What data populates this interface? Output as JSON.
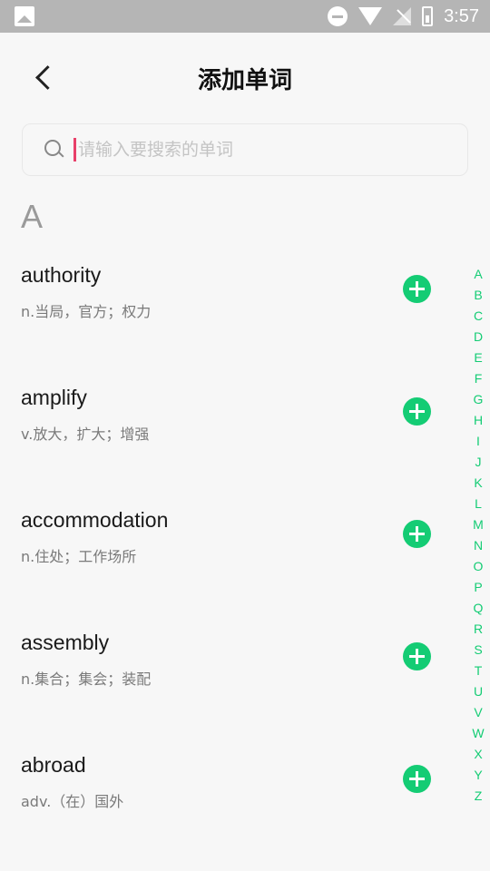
{
  "status_bar": {
    "time": "3:57",
    "icons": [
      "gallery-icon",
      "do-not-disturb-icon",
      "wifi-icon",
      "signal-off-icon",
      "battery-icon"
    ]
  },
  "header": {
    "title": "添加单词",
    "back_icon": "chevron-left-icon"
  },
  "search": {
    "placeholder": "请输入要搜索的单词",
    "value": ""
  },
  "section": {
    "letter": "A"
  },
  "words": [
    {
      "word": "authority",
      "meaning": "n.当局，官方；权力"
    },
    {
      "word": "amplify",
      "meaning": "v.放大，扩大；增强"
    },
    {
      "word": "accommodation",
      "meaning": "n.住处；工作场所"
    },
    {
      "word": "assembly",
      "meaning": "n.集合；集会；装配"
    },
    {
      "word": "abroad",
      "meaning": "adv.（在）国外"
    }
  ],
  "alphabet_index": [
    "A",
    "B",
    "C",
    "D",
    "E",
    "F",
    "G",
    "H",
    "I",
    "J",
    "K",
    "L",
    "M",
    "N",
    "O",
    "P",
    "Q",
    "R",
    "S",
    "T",
    "U",
    "V",
    "W",
    "X",
    "Y",
    "Z"
  ],
  "colors": {
    "accent": "#14cc74",
    "caret": "#e8406a",
    "status_bar": "#b5b5b5"
  }
}
